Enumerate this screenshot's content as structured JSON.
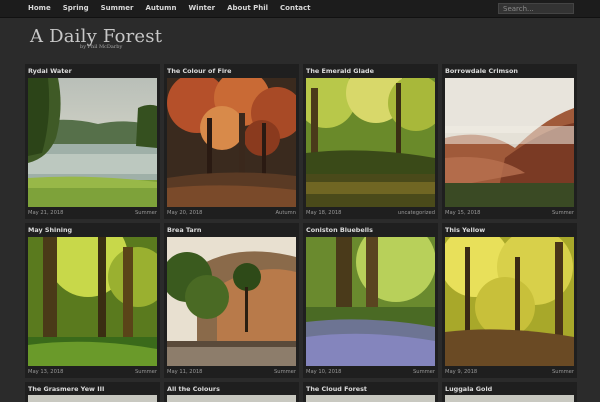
{
  "nav": {
    "items": [
      "Home",
      "Spring",
      "Summer",
      "Autumn",
      "Winter",
      "About Phil",
      "Contact"
    ],
    "search_placeholder": "Search..."
  },
  "site": {
    "title": "A Daily Forest",
    "byline": "by Phil McDarby"
  },
  "posts": [
    {
      "title": "Rydal Water",
      "date": "May 21, 2018",
      "category": "Summer"
    },
    {
      "title": "The Colour of Fire",
      "date": "May 20, 2018",
      "category": "Autumn"
    },
    {
      "title": "The Emerald Glade",
      "date": "May 18, 2018",
      "category": "uncategorized"
    },
    {
      "title": "Borrowdale Crimson",
      "date": "May 15, 2018",
      "category": "Summer"
    },
    {
      "title": "May Shining",
      "date": "May 13, 2018",
      "category": "Summer"
    },
    {
      "title": "Brea Tarn",
      "date": "May 11, 2018",
      "category": "Summer"
    },
    {
      "title": "Coniston Bluebells",
      "date": "May 10, 2018",
      "category": "Summer"
    },
    {
      "title": "This Yellow",
      "date": "May 9, 2018",
      "category": "Summer"
    },
    {
      "title": "The Grasmere Yew III",
      "date": "",
      "category": ""
    },
    {
      "title": "All the Colours",
      "date": "",
      "category": ""
    },
    {
      "title": "The Cloud Forest",
      "date": "",
      "category": ""
    },
    {
      "title": "Luggala Gold",
      "date": "",
      "category": ""
    }
  ]
}
